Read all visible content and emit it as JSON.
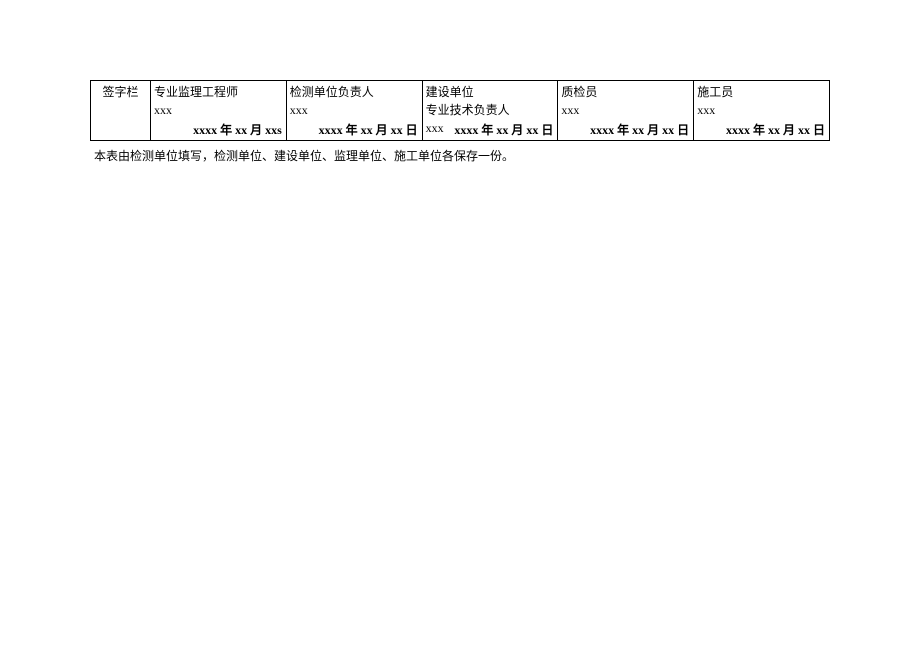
{
  "table": {
    "label": "签字栏",
    "columns": [
      {
        "role": "专业监理工程师",
        "role2": "",
        "name": "xxx",
        "date": "xxxx 年 xx 月 xxs"
      },
      {
        "role": "检测单位负责人",
        "role2": "",
        "name": "xxx",
        "date": "xxxx 年 xx 月 xx 日"
      },
      {
        "role": "建设单位",
        "role2": "专业技术负责人",
        "name": "xxx",
        "date": "xxxx 年 xx 月 xx 日"
      },
      {
        "role": "质检员",
        "role2": "",
        "name": "xxx",
        "date": "xxxx 年 xx 月 xx 日"
      },
      {
        "role": "施工员",
        "role2": "",
        "name": "xxx",
        "date": "xxxx 年 xx 月 xx 日"
      }
    ]
  },
  "footnote": "本表由检测单位填写，检测单位、建设单位、监理单位、施工单位各保存一份。"
}
